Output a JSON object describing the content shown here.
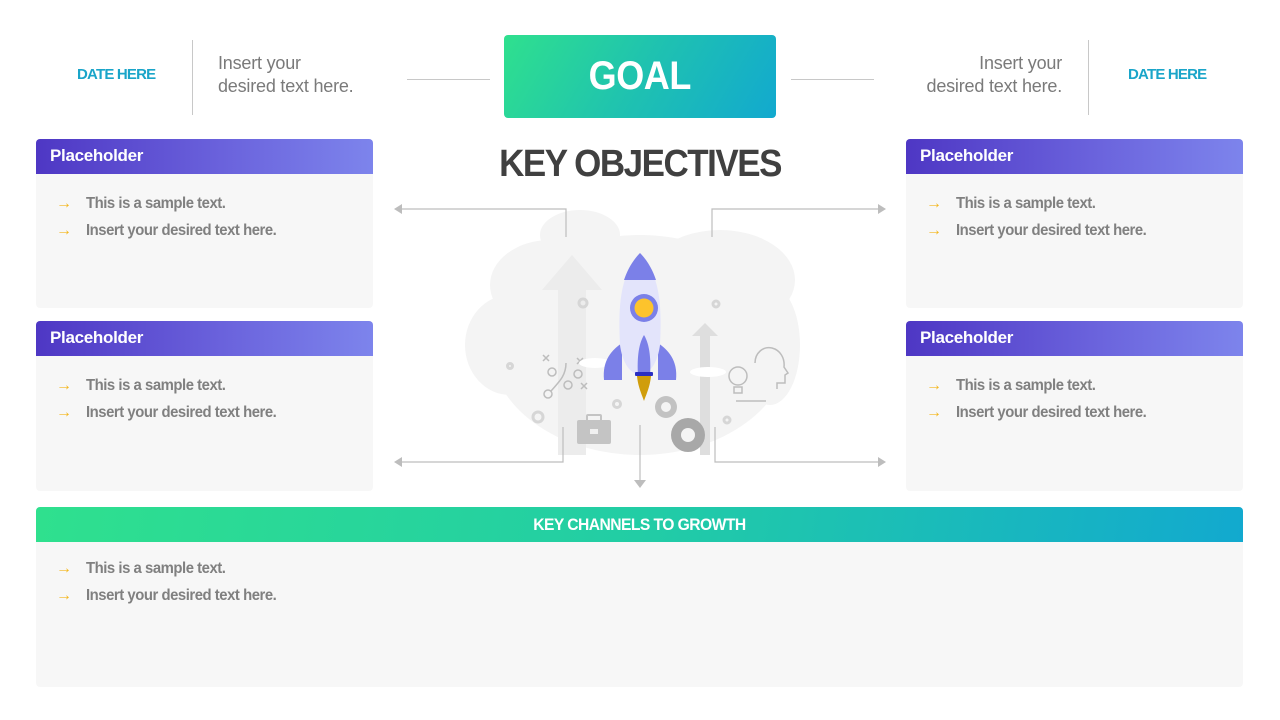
{
  "header": {
    "left_date": "DATE HERE",
    "left_text_line1": "Insert your",
    "left_text_line2": "desired text here.",
    "goal_label": "GOAL",
    "right_text_line1": "Insert your",
    "right_text_line2": "desired text here.",
    "right_date": "DATE HERE"
  },
  "center": {
    "title": "KEY OBJECTIVES",
    "illustration": "rocket-launch-illustration"
  },
  "cards": [
    {
      "title": "Placeholder",
      "bullets": [
        "This is a sample text.",
        "Insert your desired text here."
      ]
    },
    {
      "title": "Placeholder",
      "bullets": [
        "This is a sample text.",
        "Insert your desired text here."
      ]
    },
    {
      "title": "Placeholder",
      "bullets": [
        "This is a sample text.",
        "Insert your desired text here."
      ]
    },
    {
      "title": "Placeholder",
      "bullets": [
        "This is a sample text.",
        "Insert your desired text here."
      ]
    }
  ],
  "growth": {
    "title": "KEY CHANNELS TO GROWTH",
    "bullets": [
      "This is a sample text.",
      "Insert your desired text here."
    ]
  },
  "bullet_icon": "arrow-right-icon",
  "colors": {
    "date": "#1aa5c9",
    "goal_gradient_start": "#2fe08e",
    "goal_gradient_end": "#12a9cf",
    "card_header_start": "#4e37c4",
    "card_header_end": "#7d84ec",
    "bullet_arrow": "#f4b820",
    "card_body": "#f7f7f7"
  }
}
